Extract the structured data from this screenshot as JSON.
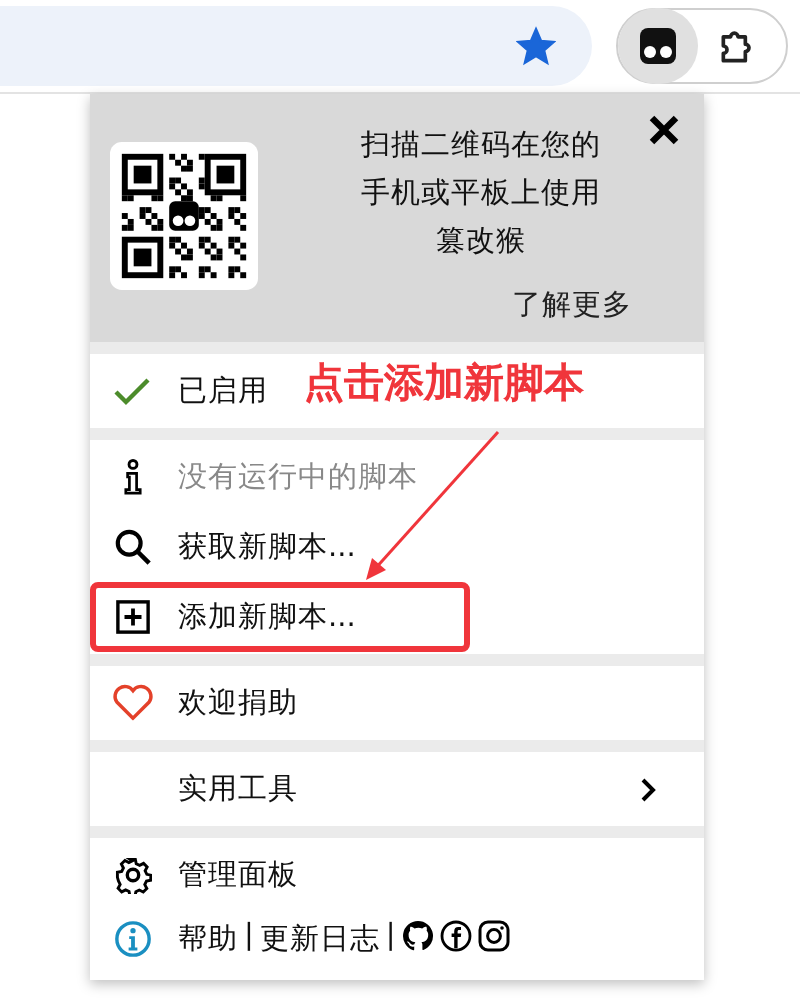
{
  "toolbar": {
    "bookmarked": true
  },
  "popup": {
    "promo": {
      "text": "扫描二维码在您的手机或平板上使用篡改猴",
      "link": "了解更多"
    },
    "sections": [
      {
        "items": [
          {
            "kind": "enabled",
            "label": "已启用",
            "disabled": false,
            "highlighted": false
          }
        ]
      },
      {
        "items": [
          {
            "kind": "info",
            "label": "没有运行中的脚本",
            "disabled": true,
            "highlighted": false
          },
          {
            "kind": "search",
            "label": "获取新脚本...",
            "disabled": false,
            "highlighted": false
          },
          {
            "kind": "add",
            "label": "添加新脚本...",
            "disabled": false,
            "highlighted": true
          }
        ]
      },
      {
        "items": [
          {
            "kind": "donate",
            "label": "欢迎捐助",
            "disabled": false,
            "highlighted": false
          }
        ]
      },
      {
        "items": [
          {
            "kind": "submenu",
            "label": "实用工具",
            "disabled": false,
            "highlighted": false
          }
        ]
      },
      {
        "items": [
          {
            "kind": "dashboard",
            "label": "管理面板",
            "disabled": false,
            "highlighted": false
          }
        ]
      }
    ],
    "footer": {
      "links": [
        "帮助",
        "更新日志"
      ],
      "separator": "|"
    }
  },
  "annotation": {
    "text": "点击添加新脚本"
  }
}
